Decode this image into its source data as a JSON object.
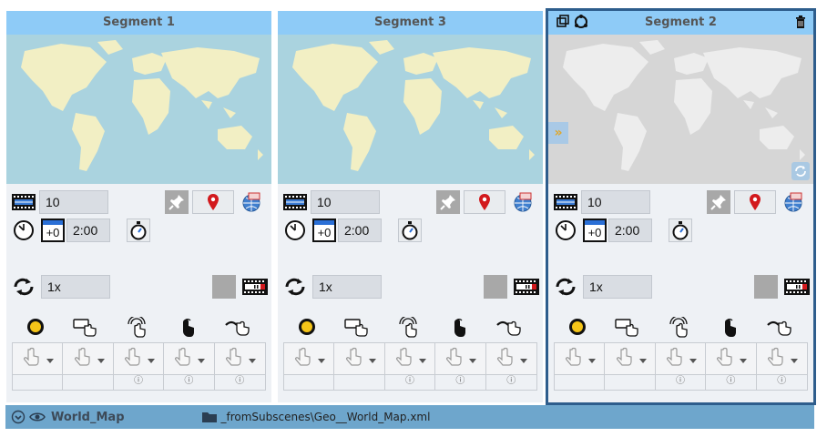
{
  "panels": [
    {
      "title": "Segment 1",
      "duration": "10",
      "time_offset": "+0",
      "time": "2:00",
      "loop": "1x",
      "selected": false,
      "map_style": "color"
    },
    {
      "title": "Segment 3",
      "duration": "10",
      "time_offset": "+0",
      "time": "2:00",
      "loop": "1x",
      "selected": false,
      "map_style": "color"
    },
    {
      "title": "Segment 2",
      "duration": "10",
      "time_offset": "+0",
      "time": "2:00",
      "loop": "1x",
      "selected": true,
      "map_style": "gray"
    }
  ],
  "info_glyph": "ⓘ",
  "bottom": {
    "name": "World_Map",
    "path": "_fromSubscenes\\Geo__World_Map.xml"
  },
  "icons": {
    "duration": "film-strip-icon",
    "clock": "clock-icon",
    "calendar": "calendar-icon",
    "stopwatch": "stopwatch-icon",
    "pin": "pushpin-icon",
    "location": "location-pin-icon",
    "globe": "globe-icon",
    "loop": "loop-icon",
    "film_end": "film-end-icon",
    "dot": "record-dot-icon",
    "hand": "hand-pointer-icon"
  },
  "colors": {
    "header": "#8ecbf7",
    "ocean": "#aad3df",
    "land": "#f2efc4",
    "gray_ocean": "#d6d6d6",
    "gray_land": "#ededed",
    "bottom_bar": "#6ea6cc",
    "selected_outline": "#2e5d8c",
    "pin_red": "#d2191d"
  }
}
